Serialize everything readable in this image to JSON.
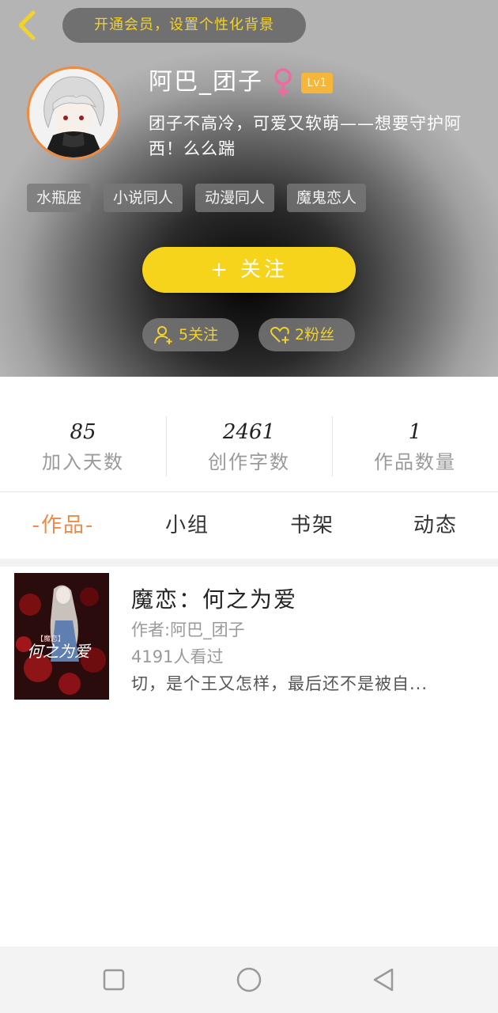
{
  "header": {
    "vip_banner": "开通会员，设置个性化背景",
    "username": "阿巴_团子",
    "level": "Lv1",
    "bio": "团子不高冷，可爱又软萌——想要守护阿西！么么踹",
    "tags": [
      "水瓶座",
      "小说同人",
      "动漫同人",
      "魔鬼恋人"
    ],
    "follow_button": "关注",
    "follow_plus": "+",
    "following_label": "5关注",
    "fans_label": "2粉丝"
  },
  "stats": [
    {
      "value": "85",
      "label": "加入天数"
    },
    {
      "value": "2461",
      "label": "创作字数"
    },
    {
      "value": "1",
      "label": "作品数量"
    }
  ],
  "tabs": [
    "-作品-",
    "小组",
    "书架",
    "动态"
  ],
  "active_tab_index": 0,
  "works": [
    {
      "title": "魔恋：何之为爱",
      "author": "作者:阿巴_团子",
      "views": "4191人看过",
      "description": "切，是个王又怎样，最后还不是被自..."
    }
  ],
  "icons": {
    "back": "chevron-left-icon",
    "gender": "female-icon",
    "following": "user-plus-icon",
    "fans": "heart-plus-icon",
    "nav": [
      "square-icon",
      "circle-icon",
      "triangle-back-icon"
    ]
  },
  "colors": {
    "accent_yellow": "#f7d41c",
    "accent_orange": "#ee8a47",
    "female_pink": "#f06aa0",
    "level_badge": "#f5b63a"
  }
}
